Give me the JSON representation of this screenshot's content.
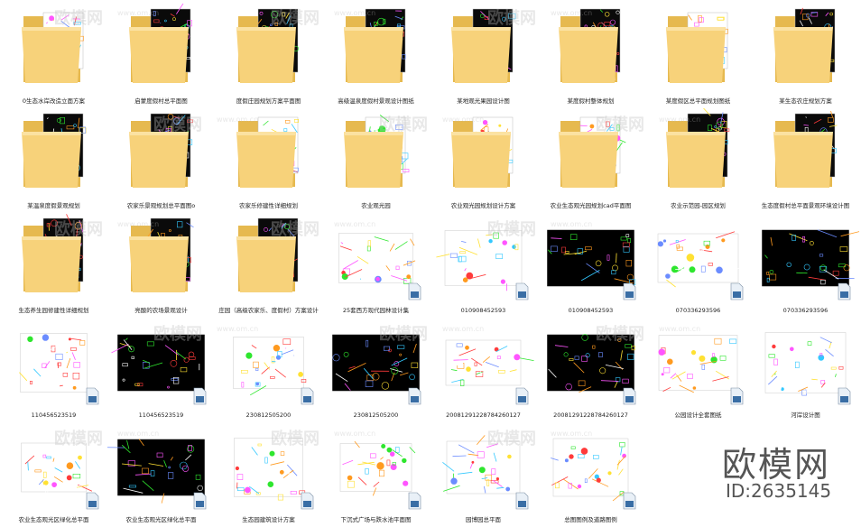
{
  "watermark": {
    "text": "欧模网",
    "url": "www.om.cn"
  },
  "brand": {
    "name": "欧模网",
    "id": "ID:2635145"
  },
  "files": [
    {
      "label": "0生态水岸改造立面方案",
      "kind": "folder",
      "theme": "white"
    },
    {
      "label": "启蒙度假村总平面图",
      "kind": "folder",
      "theme": "dark"
    },
    {
      "label": "度假庄园规划方案平面图",
      "kind": "folder",
      "theme": "dark"
    },
    {
      "label": "高级温泉度假村景观设计图纸",
      "kind": "folder",
      "theme": "dark"
    },
    {
      "label": "某地观光果园设计图",
      "kind": "folder",
      "theme": "dark"
    },
    {
      "label": "某度假村整体规划",
      "kind": "folder",
      "theme": "dark"
    },
    {
      "label": "某度假区总平面规划图纸",
      "kind": "folder",
      "theme": "white"
    },
    {
      "label": "某生态农庄规划方案",
      "kind": "folder",
      "theme": "dark"
    },
    {
      "label": "某温泉度假景观规划",
      "kind": "folder",
      "theme": "dark"
    },
    {
      "label": "农家乐景观规划总平面图o",
      "kind": "folder",
      "theme": "dark"
    },
    {
      "label": "农家乐修建性详细规划",
      "kind": "folder",
      "theme": "white"
    },
    {
      "label": "农业观光园",
      "kind": "folder",
      "theme": "white"
    },
    {
      "label": "农业观光园规划设计方案",
      "kind": "folder",
      "theme": "white"
    },
    {
      "label": "农业生态观光园规划cad平面图",
      "kind": "folder",
      "theme": "white"
    },
    {
      "label": "农业示范园-园区规划",
      "kind": "folder",
      "theme": "dark"
    },
    {
      "label": "生态度假村总平面景观环境设计图",
      "kind": "folder",
      "theme": "dark"
    },
    {
      "label": "生态养生园修建性详细规划",
      "kind": "folder",
      "theme": "dark"
    },
    {
      "label": "亮酸的农场景观设计",
      "kind": "folder",
      "theme": "dark"
    },
    {
      "label": "庄园（高级农家乐、度假村）方案设计",
      "kind": "folder",
      "theme": "dark"
    },
    {
      "label": "25套西方现代园林设计集",
      "kind": "image",
      "theme": "white"
    },
    {
      "label": "010908452593",
      "kind": "image",
      "theme": "white"
    },
    {
      "label": "010908452593",
      "kind": "image",
      "theme": "dark"
    },
    {
      "label": "070336293596",
      "kind": "image",
      "theme": "white"
    },
    {
      "label": "070336293596",
      "kind": "image",
      "theme": "dark"
    },
    {
      "label": "110456523519",
      "kind": "image",
      "theme": "white"
    },
    {
      "label": "110456523519",
      "kind": "image",
      "theme": "dark"
    },
    {
      "label": "230812505200",
      "kind": "image",
      "theme": "white"
    },
    {
      "label": "230812505200",
      "kind": "image",
      "theme": "dark"
    },
    {
      "label": "20081291228784260127",
      "kind": "image",
      "theme": "white"
    },
    {
      "label": "20081291228784260127",
      "kind": "image",
      "theme": "dark"
    },
    {
      "label": "公园设计全套图纸",
      "kind": "image",
      "theme": "white"
    },
    {
      "label": "河岸设计图",
      "kind": "image",
      "theme": "white"
    },
    {
      "label": "农业生态观光区绿化总平面",
      "kind": "image",
      "theme": "white"
    },
    {
      "label": "农业生态观光区绿化总平面",
      "kind": "image",
      "theme": "dark"
    },
    {
      "label": "生态园建筑设计方案",
      "kind": "image",
      "theme": "white"
    },
    {
      "label": "下沉式广场与跌水池平面图",
      "kind": "image",
      "theme": "white"
    },
    {
      "label": "园博园总平面",
      "kind": "image",
      "theme": "white"
    },
    {
      "label": "总图图例及道路图例",
      "kind": "image",
      "theme": "white"
    }
  ]
}
